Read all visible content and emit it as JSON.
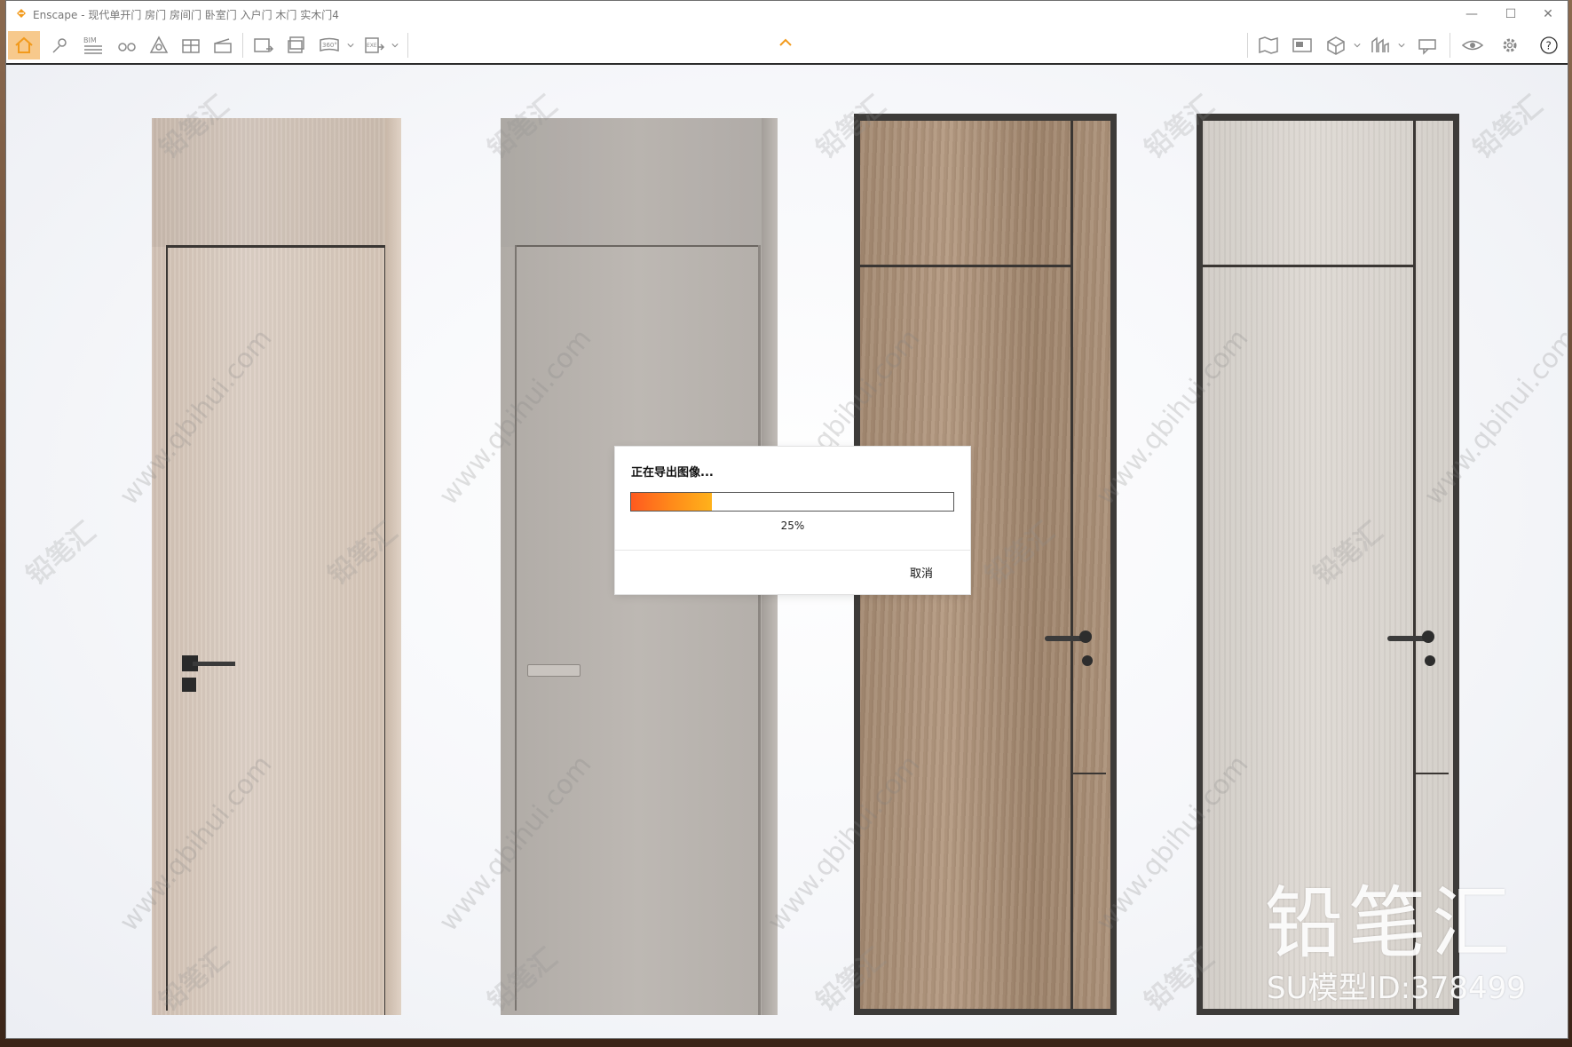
{
  "window": {
    "title": "Enscape - 现代单开门 房门 房间门 卧室门 入户门 木门 实木门4",
    "minimize": "—",
    "maximize": "☐",
    "close": "✕"
  },
  "toolbar": {
    "bim_label": "BIM",
    "panorama_label": "360°",
    "exe_label": "EXE",
    "help_label": "?"
  },
  "dialog": {
    "title": "正在导出图像...",
    "progress": 0.25,
    "progress_text": "25%",
    "cancel_label": "取消"
  },
  "overlay": {
    "brand": "铅笔汇",
    "model_id": "SU模型ID:378499",
    "watermark_cn": "铅笔汇",
    "watermark_url": "www.qbihui.com"
  },
  "colors": {
    "accent_orange": "#f29a1c",
    "active_tool_bg": "#f7c98c",
    "progress_start": "#ff5a1f",
    "progress_end": "#ffb21b"
  }
}
